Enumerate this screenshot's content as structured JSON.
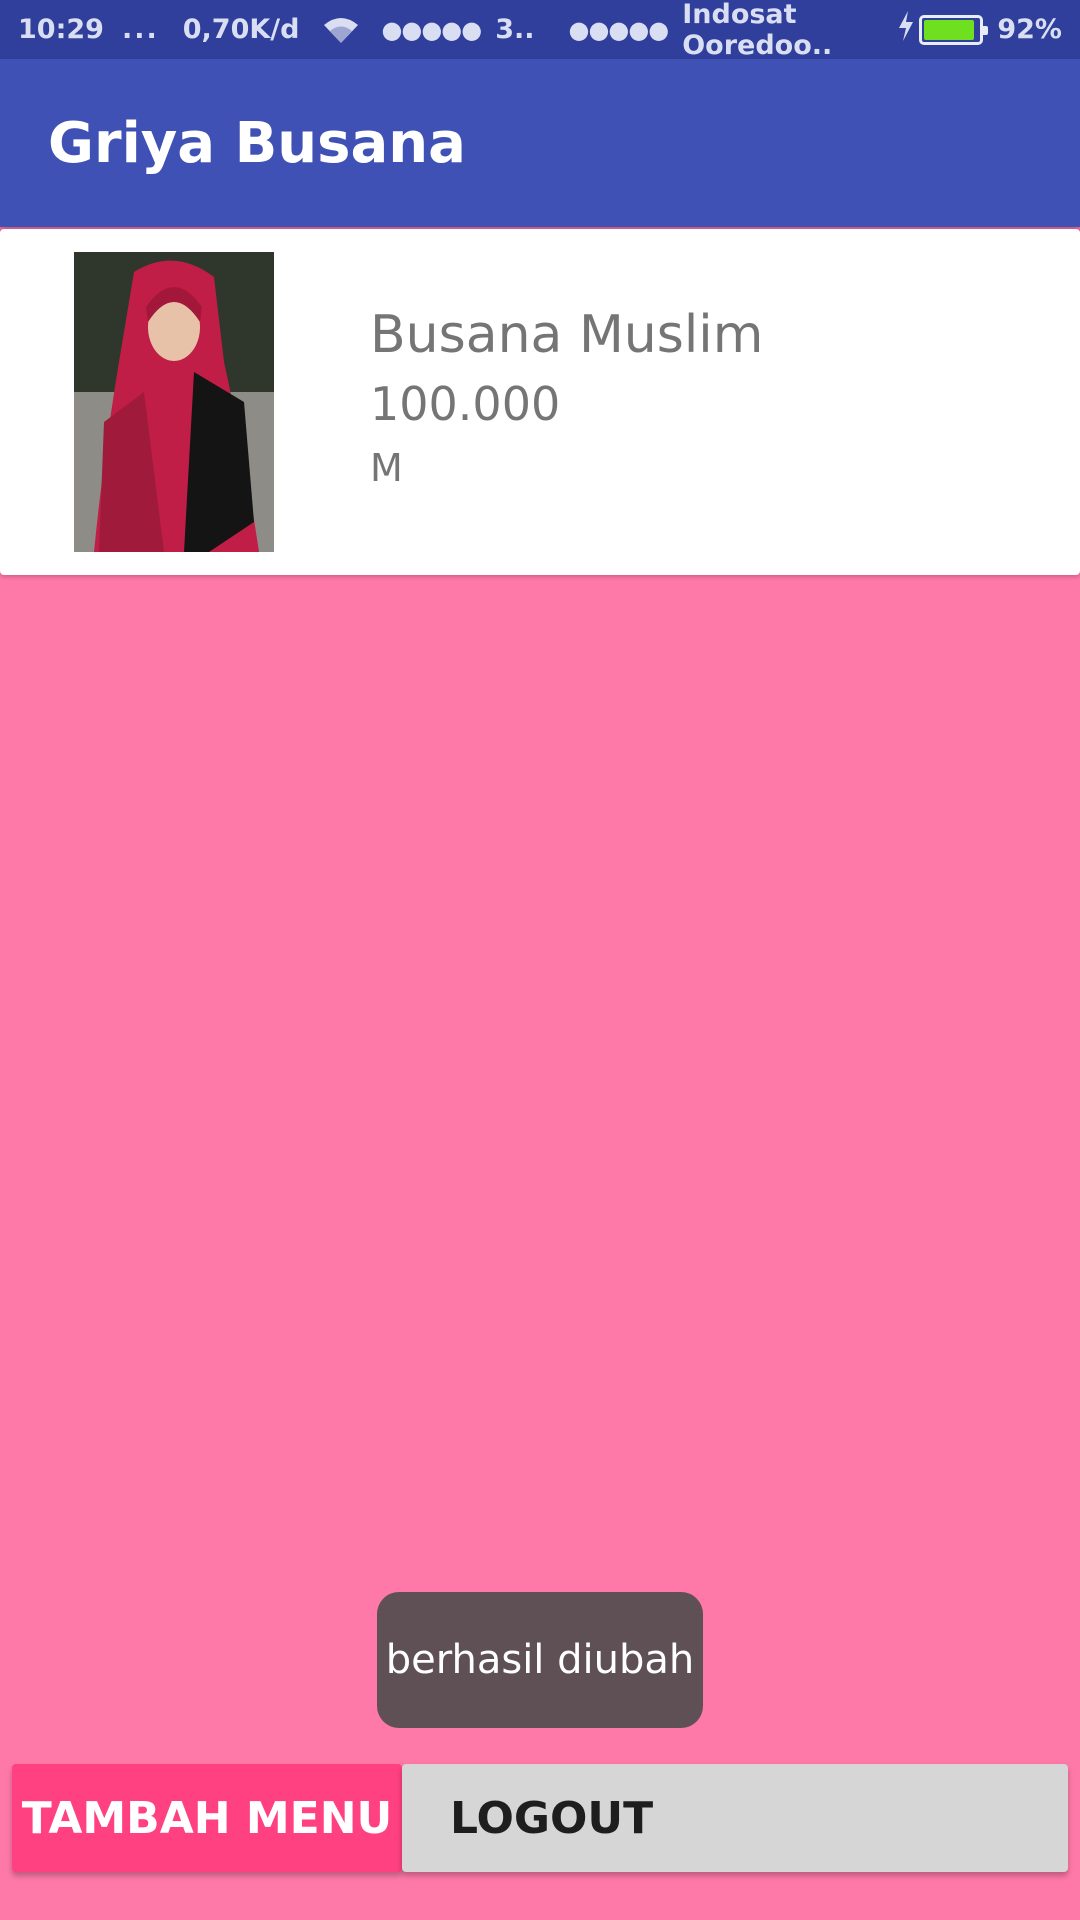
{
  "status_bar": {
    "time": "10:29",
    "dots": "...",
    "speed": "0,70K/d",
    "signal_dots_1": "●●●●●",
    "sim1_label": "3..",
    "signal_dots_2": "●●●●●",
    "carrier": "Indosat Ooredoo..",
    "battery_percent": "92%",
    "battery_level": 0.92,
    "icons": [
      "wifi-icon",
      "charging-icon",
      "battery-icon"
    ]
  },
  "app_bar": {
    "title": "Griya Busana"
  },
  "product_list": [
    {
      "name": "Busana Muslim",
      "price": "100.000",
      "size": "M"
    }
  ],
  "toast": {
    "message": "berhasil diubah"
  },
  "buttons": {
    "tambah_menu": "TAMBAH MENU",
    "logout": "LOGOUT"
  },
  "colors": {
    "status_bar": "#2f3f9b",
    "app_bar": "#3f51b5",
    "background": "#ff79a8",
    "accent_button": "#ff4081",
    "secondary_button": "#d6d6d6",
    "toast": "#5e5055"
  }
}
